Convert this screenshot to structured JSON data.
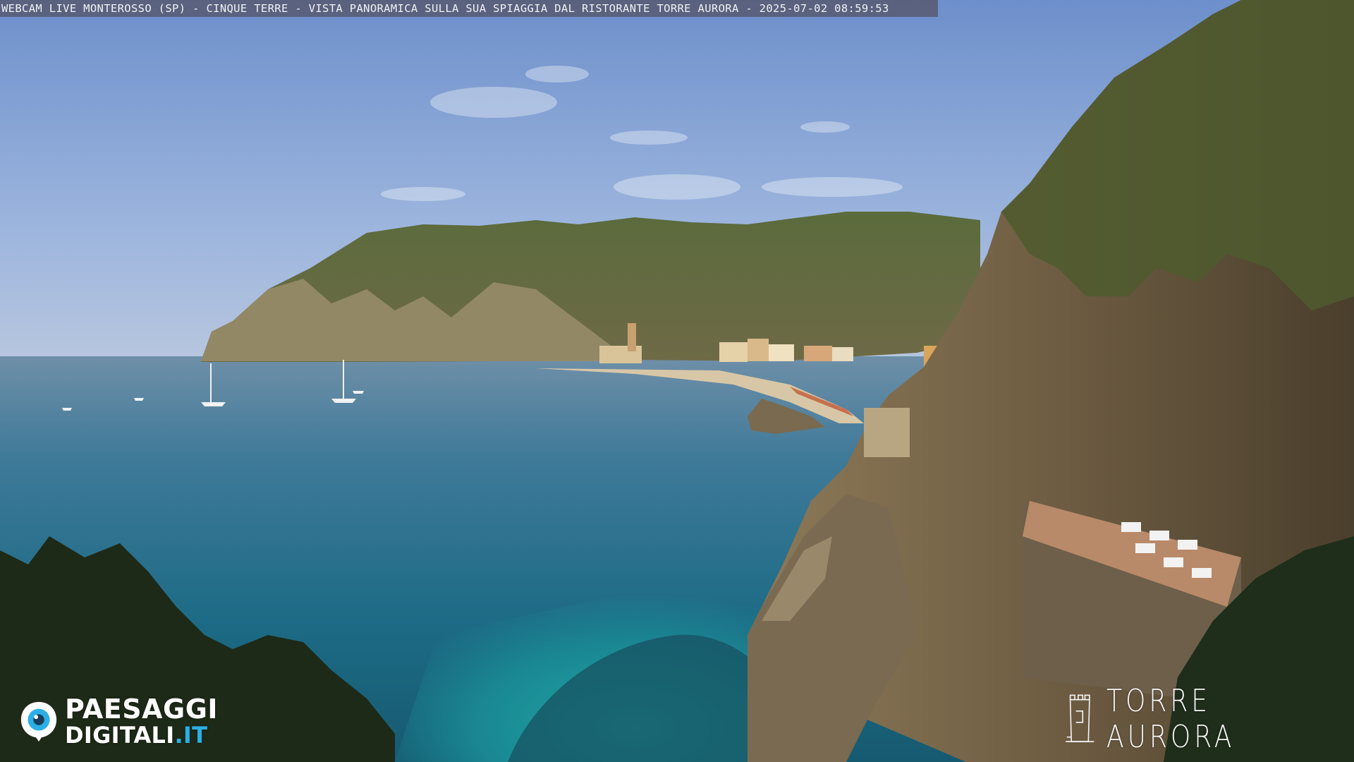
{
  "overlay": {
    "caption": "WEBCAM LIVE MONTEROSSO (SP) - CINQUE TERRE - VISTA PANORAMICA SULLA SUA SPIAGGIA DAL RISTORANTE TORRE AURORA - 2025-07-02 08:59:53"
  },
  "logos": {
    "left": {
      "line1": "PAESAGGI",
      "line2_main": "DIGITALI",
      "line2_tld": ".IT",
      "accent_color": "#2ab0e6",
      "icon": "eye-icon"
    },
    "right": {
      "text": "TORRE AURORA",
      "icon": "tower-icon"
    }
  },
  "scene": {
    "sky_color": "#7f9fd0",
    "sea_color": "#1e6f8a",
    "shallow_water_color": "#1ea6a8",
    "hill_color": "#5d6b3a",
    "cliff_color": "#8a7552"
  }
}
